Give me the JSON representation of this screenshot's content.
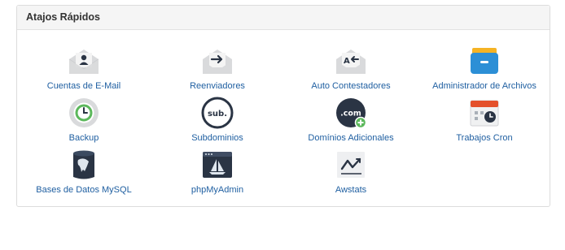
{
  "panel": {
    "title": "Atajos Rápidos"
  },
  "items": [
    {
      "label": "Cuentas de E-Mail",
      "icon": "email-accounts-icon"
    },
    {
      "label": "Reenviadores",
      "icon": "forwarders-icon"
    },
    {
      "label": "Auto Contestadores",
      "icon": "autoresponders-icon"
    },
    {
      "label": "Administrador de Archivos",
      "icon": "file-manager-icon"
    },
    {
      "label": "Backup",
      "icon": "backup-icon"
    },
    {
      "label": "Subdominios",
      "icon": "subdomains-icon"
    },
    {
      "label": "Domínios Adicionales",
      "icon": "addon-domains-icon"
    },
    {
      "label": "Trabajos Cron",
      "icon": "cron-jobs-icon"
    },
    {
      "label": "Bases de Datos MySQL",
      "icon": "mysql-databases-icon"
    },
    {
      "label": "phpMyAdmin",
      "icon": "phpmyadmin-icon"
    },
    {
      "label": "Awstats",
      "icon": "awstats-icon"
    }
  ],
  "icon_text": {
    "subdomains": "sub.",
    "addon_domains": ".com",
    "autoresponders": "A"
  },
  "colors": {
    "link": "#1f5fa1",
    "envelope": "#d9dadc",
    "file_manager": "#2c8fd6",
    "folder_tab": "#f5b324",
    "dark_navy": "#2a3444",
    "green": "#5cb85c",
    "cron_red": "#e4502b"
  }
}
